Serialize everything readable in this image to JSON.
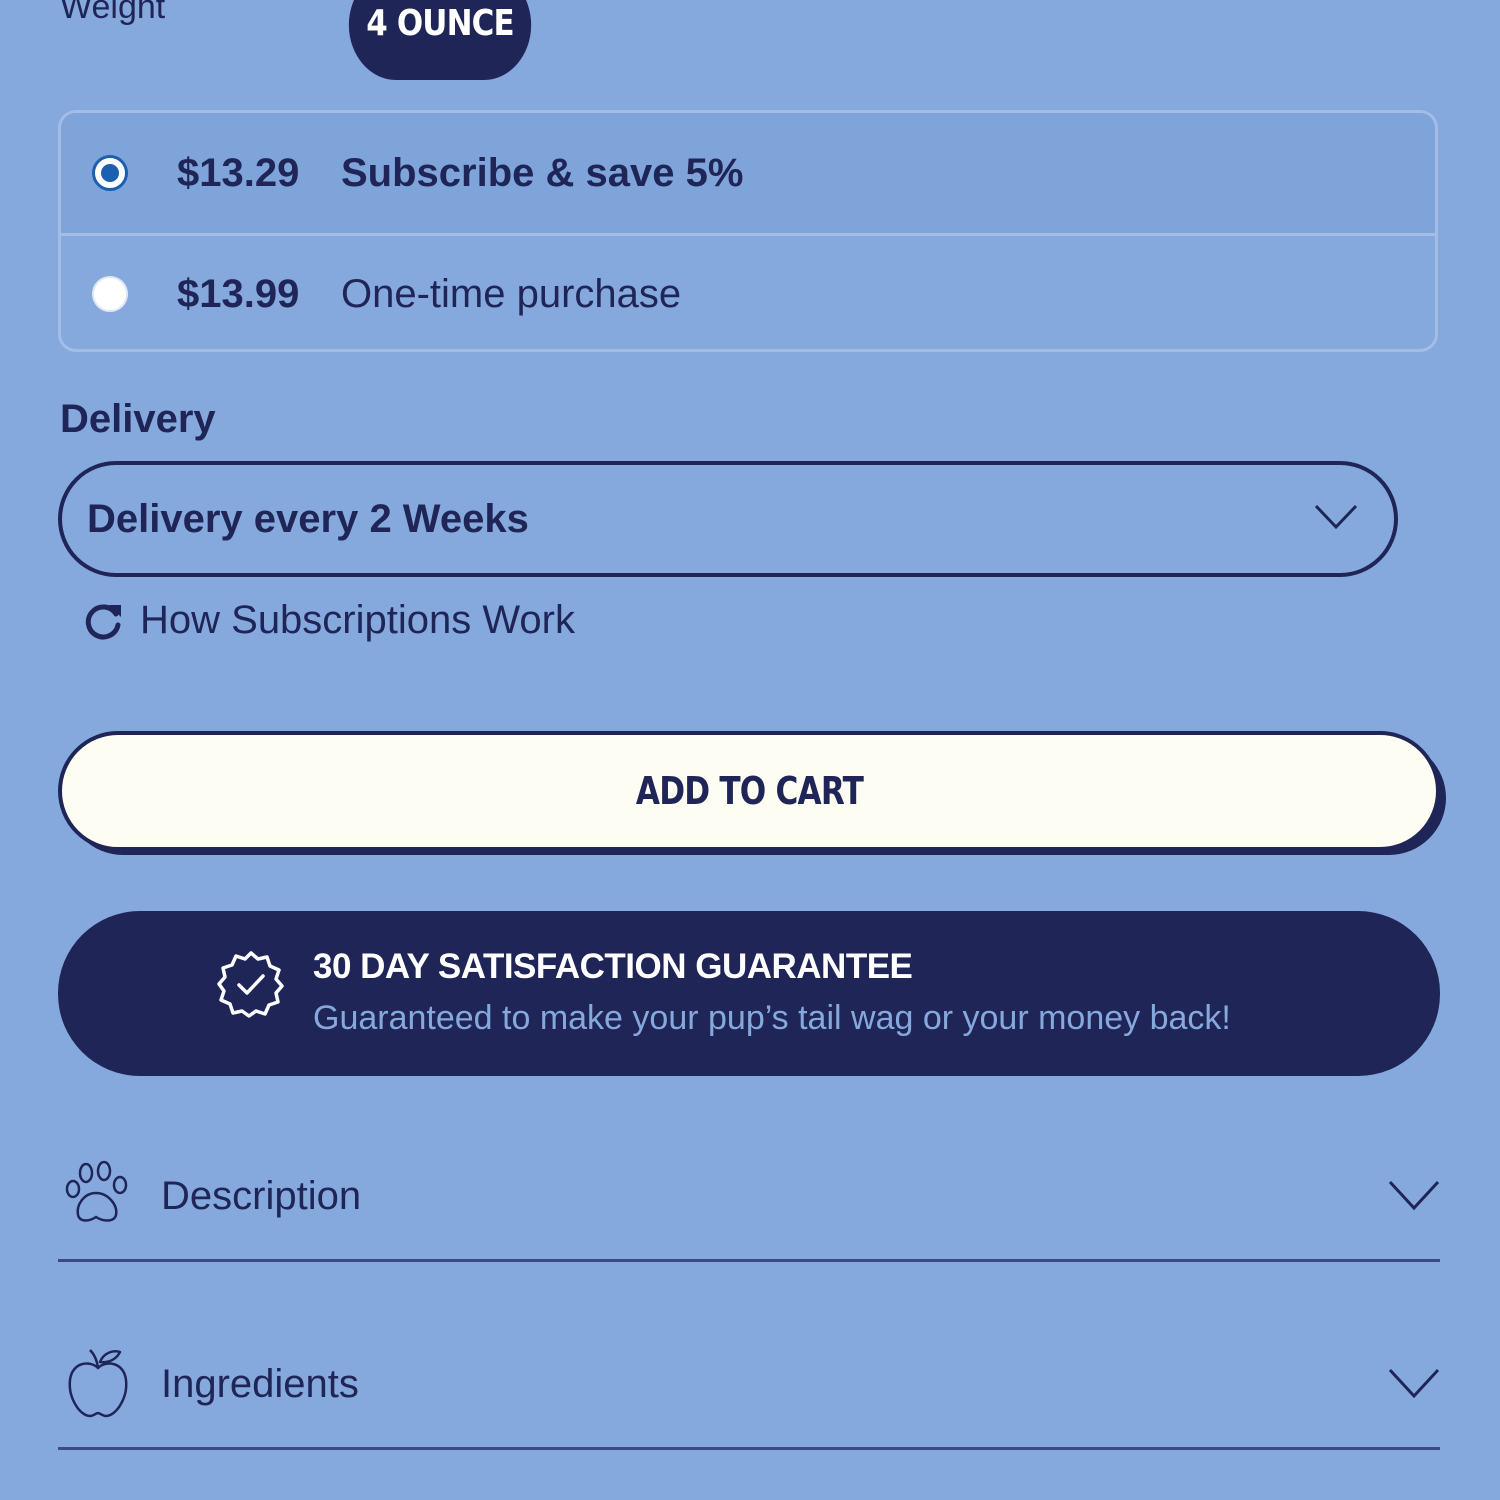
{
  "weight": {
    "label": "Weight",
    "selected_option": "4 OUNCE"
  },
  "purchase_options": [
    {
      "price": "$13.29",
      "label": "Subscribe & save 5%",
      "selected": true
    },
    {
      "price": "$13.99",
      "label": "One-time purchase",
      "selected": false
    }
  ],
  "delivery": {
    "heading": "Delivery",
    "selected_frequency": "Delivery every 2 Weeks",
    "icon": "chevron-down-icon"
  },
  "subscriptions_link": {
    "label": "How Subscriptions Work",
    "icon": "refresh-icon"
  },
  "add_to_cart": {
    "label": "ADD TO CART"
  },
  "guarantee": {
    "title": "30 DAY SATISFACTION GUARANTEE",
    "subtitle": "Guaranteed to make your pup’s tail wag or your money back!",
    "icon": "check-badge-icon"
  },
  "accordions": [
    {
      "label": "Description",
      "icon": "paw-icon"
    },
    {
      "label": "Ingredients",
      "icon": "apple-icon"
    }
  ],
  "colors": {
    "background": "#86a9dd",
    "navy": "#1f2557",
    "cream": "#fefdf4",
    "radio_accent": "#1a5fb0"
  }
}
